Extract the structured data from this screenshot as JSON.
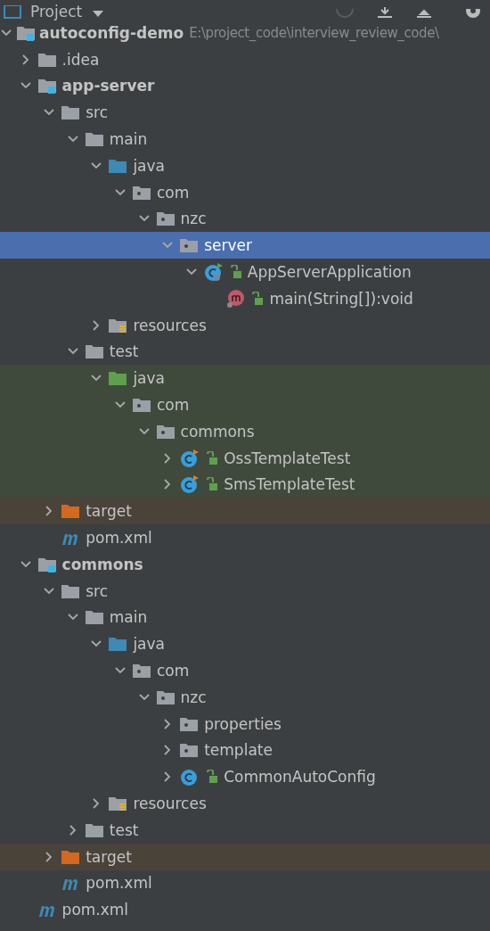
{
  "panel": {
    "title": "Project"
  },
  "tree": [
    {
      "label": "autoconfig-demo",
      "kind": "module",
      "path": "E:\\project_code\\interview_review_code\\",
      "expanded": true,
      "selected": false,
      "children": [
        {
          "label": ".idea",
          "kind": "folder",
          "expanded": false,
          "selected": false
        },
        {
          "label": "app-server",
          "kind": "module",
          "expanded": true,
          "selected": false,
          "children": [
            {
              "label": "src",
              "kind": "folder",
              "expanded": true,
              "selected": false,
              "children": [
                {
                  "label": "main",
                  "kind": "folder",
                  "expanded": true,
                  "selected": false,
                  "children": [
                    {
                      "label": "java",
                      "kind": "source",
                      "expanded": true,
                      "selected": false,
                      "children": [
                        {
                          "label": "com",
                          "kind": "package",
                          "expanded": true,
                          "selected": false,
                          "children": [
                            {
                              "label": "nzc",
                              "kind": "package",
                              "expanded": true,
                              "selected": false,
                              "children": [
                                {
                                  "label": "server",
                                  "kind": "package",
                                  "expanded": true,
                                  "selected": true,
                                  "children": [
                                    {
                                      "label": "AppServerApplication",
                                      "kind": "spring-class",
                                      "expanded": true,
                                      "selected": false,
                                      "children": [
                                        {
                                          "label": "main(String[]):void",
                                          "kind": "method",
                                          "selected": false
                                        }
                                      ]
                                    }
                                  ]
                                }
                              ]
                            }
                          ]
                        }
                      ]
                    },
                    {
                      "label": "resources",
                      "kind": "resources",
                      "expanded": false,
                      "selected": false
                    }
                  ]
                },
                {
                  "label": "test",
                  "kind": "folder",
                  "expanded": true,
                  "selected": false,
                  "children": [
                    {
                      "label": "java",
                      "kind": "test-source",
                      "test_scope": true,
                      "expanded": true,
                      "selected": false,
                      "children": [
                        {
                          "label": "com",
                          "kind": "package",
                          "test_scope": true,
                          "expanded": true,
                          "selected": false,
                          "children": [
                            {
                              "label": "commons",
                              "kind": "package",
                              "test_scope": true,
                              "expanded": true,
                              "selected": false,
                              "children": [
                                {
                                  "label": "OssTemplateTest",
                                  "kind": "test-class",
                                  "test_scope": true,
                                  "expanded": false,
                                  "selected": false
                                },
                                {
                                  "label": "SmsTemplateTest",
                                  "kind": "test-class",
                                  "test_scope": true,
                                  "expanded": false,
                                  "selected": false
                                }
                              ]
                            }
                          ]
                        }
                      ]
                    }
                  ]
                }
              ]
            },
            {
              "label": "target",
              "kind": "excluded",
              "excluded": true,
              "expanded": false,
              "selected": false
            },
            {
              "label": "pom.xml",
              "kind": "maven",
              "selected": false
            }
          ]
        },
        {
          "label": "commons",
          "kind": "module",
          "expanded": true,
          "selected": false,
          "children": [
            {
              "label": "src",
              "kind": "folder",
              "expanded": true,
              "selected": false,
              "children": [
                {
                  "label": "main",
                  "kind": "folder",
                  "expanded": true,
                  "selected": false,
                  "children": [
                    {
                      "label": "java",
                      "kind": "source",
                      "expanded": true,
                      "selected": false,
                      "children": [
                        {
                          "label": "com",
                          "kind": "package",
                          "expanded": true,
                          "selected": false,
                          "children": [
                            {
                              "label": "nzc",
                              "kind": "package",
                              "expanded": true,
                              "selected": false,
                              "children": [
                                {
                                  "label": "properties",
                                  "kind": "package",
                                  "expanded": false,
                                  "selected": false
                                },
                                {
                                  "label": "template",
                                  "kind": "package",
                                  "expanded": false,
                                  "selected": false
                                },
                                {
                                  "label": "CommonAutoConfig",
                                  "kind": "class",
                                  "expanded": false,
                                  "selected": false
                                }
                              ]
                            }
                          ]
                        }
                      ]
                    },
                    {
                      "label": "resources",
                      "kind": "resources",
                      "expanded": false,
                      "selected": false
                    }
                  ]
                },
                {
                  "label": "test",
                  "kind": "folder",
                  "expanded": false,
                  "selected": false
                }
              ]
            },
            {
              "label": "target",
              "kind": "excluded",
              "excluded": true,
              "expanded": false,
              "selected": false
            },
            {
              "label": "pom.xml",
              "kind": "maven",
              "selected": false
            }
          ]
        },
        {
          "label": "pom.xml",
          "kind": "maven",
          "selected": false
        }
      ]
    }
  ]
}
